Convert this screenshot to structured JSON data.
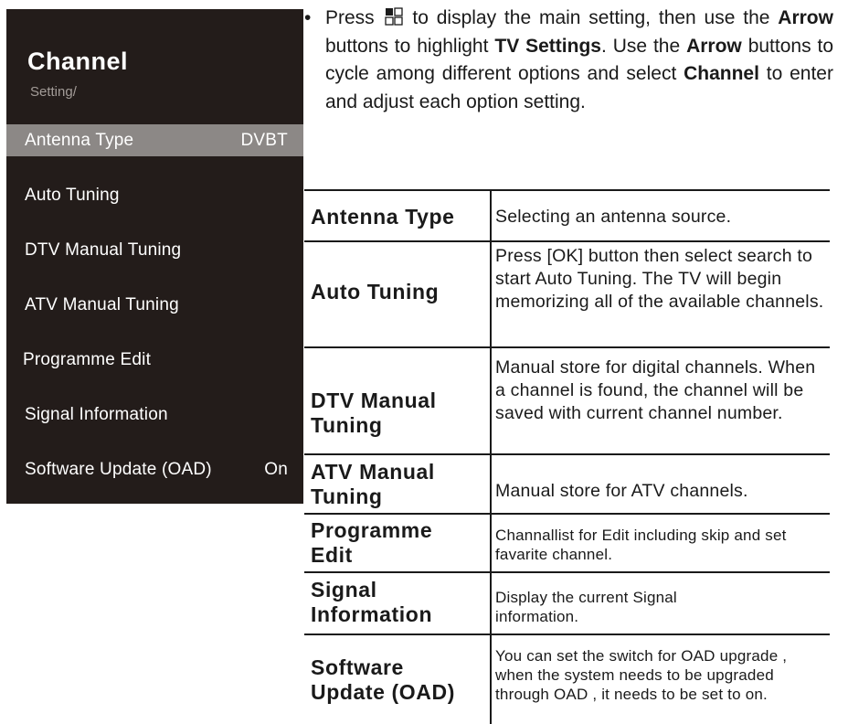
{
  "menu": {
    "title": "Channel",
    "subtitle": "Setting/",
    "items": [
      {
        "label": "Antenna Type",
        "value": "DVBT",
        "selected": true
      },
      {
        "label": "Auto Tuning",
        "value": ""
      },
      {
        "label": "DTV Manual Tuning",
        "value": ""
      },
      {
        "label": "ATV Manual Tuning",
        "value": ""
      },
      {
        "label": "Programme Edit",
        "value": ""
      },
      {
        "label": "Signal Information",
        "value": ""
      },
      {
        "label": "Software Update (OAD)",
        "value": "On"
      }
    ]
  },
  "instructions": {
    "bullet": "•",
    "press": "Press",
    "menu_key_icon": "menu-key-icon",
    "after_key": "to display the main setting, then use the",
    "arrow1": "Arrow",
    "mid1": "buttons to highlight",
    "tv_settings": "TV Settings",
    "mid2": ". Use the",
    "arrow2": "Arrow",
    "mid3": "buttons to cycle among different options and select",
    "channel": "Channel",
    "end": "to enter and adjust each option setting."
  },
  "table": {
    "rows": [
      {
        "term": "Antenna Type",
        "desc": "Selecting an antenna source."
      },
      {
        "term": "Auto Tuning",
        "desc": "Press [OK] button then select search to start Auto Tuning. The TV will begin memorizing all of the available channels."
      },
      {
        "term": "DTV Manual Tuning",
        "desc": "Manual store for digital channels. When a channel is found, the channel will be saved with current channel number."
      },
      {
        "term": "ATV Manual Tuning",
        "desc": "Manual store for ATV channels."
      },
      {
        "term": "Programme Edit",
        "desc": "Channallist for Edit including skip and set favarite channel."
      },
      {
        "term": "Signal Information",
        "desc": "Display the current Signal information."
      },
      {
        "term": "Software Update (OAD)",
        "desc": "You can set the switch for OAD upgrade , when the system needs to be upgraded through OAD , it needs to be set to on."
      }
    ]
  }
}
